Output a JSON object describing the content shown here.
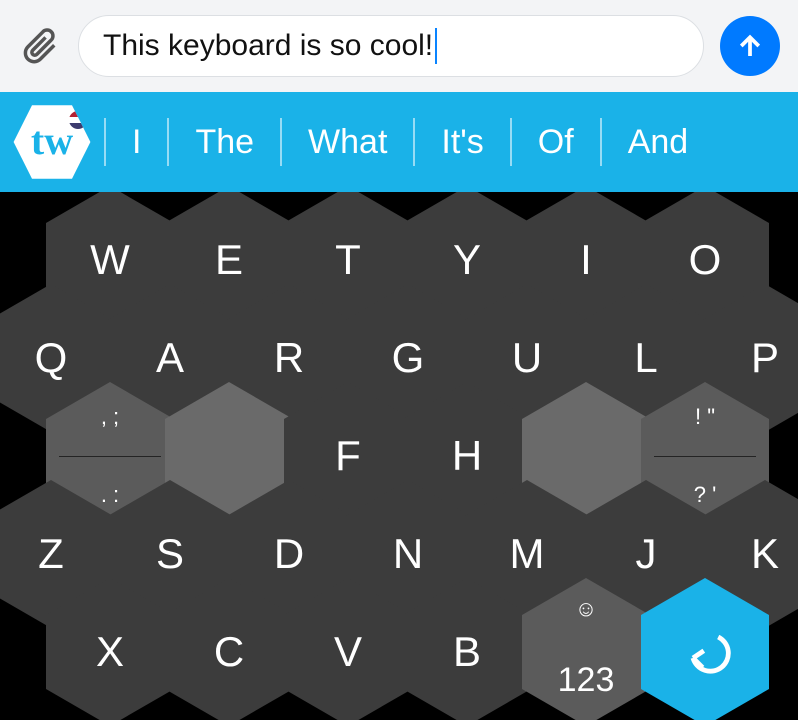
{
  "input": {
    "text": "This keyboard is so cool!"
  },
  "brand": {
    "logo_text": "tw"
  },
  "suggestions": [
    "I",
    "The",
    "What",
    "It's",
    "Of",
    "And"
  ],
  "rows": {
    "r1": [
      "W",
      "E",
      "T",
      "Y",
      "I",
      "O"
    ],
    "r2": [
      "Q",
      "A",
      "R",
      "G",
      "U",
      "L",
      "P"
    ],
    "r4": [
      "Z",
      "S",
      "D",
      "N",
      "M",
      "J",
      "K"
    ],
    "r5": [
      "X",
      "C",
      "V",
      "B"
    ]
  },
  "mid": {
    "F": "F",
    "H": "H",
    "punct1_top": ", ;",
    "punct1_bot": ". :",
    "punct2_top": "! \"",
    "punct2_bot": "? '"
  },
  "mode": {
    "emoji": "☺",
    "numbers": "123"
  }
}
